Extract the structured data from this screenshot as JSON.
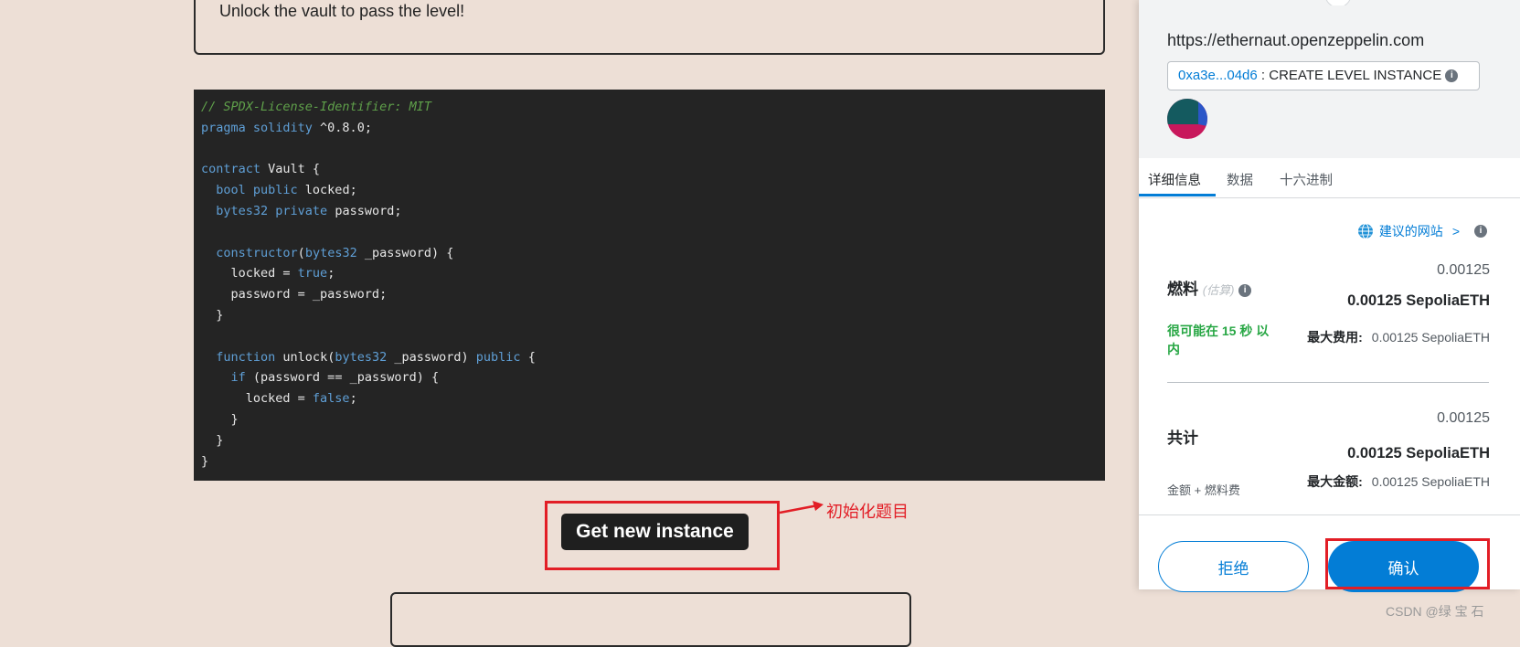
{
  "level": {
    "description": "Unlock the vault to pass the level!"
  },
  "code": {
    "lines": [
      [
        {
          "t": "// SPDX-License-Identifier: MIT",
          "c": "com"
        }
      ],
      [
        {
          "t": "pragma solidity",
          "c": "kw"
        },
        {
          "t": " ^0.8.0;",
          "c": "txt"
        }
      ],
      [],
      [
        {
          "t": "contract",
          "c": "kw"
        },
        {
          "t": " Vault {",
          "c": "txt"
        }
      ],
      [
        {
          "t": "  ",
          "c": "txt"
        },
        {
          "t": "bool public",
          "c": "kw"
        },
        {
          "t": " locked;",
          "c": "txt"
        }
      ],
      [
        {
          "t": "  ",
          "c": "txt"
        },
        {
          "t": "bytes32 private",
          "c": "kw"
        },
        {
          "t": " password;",
          "c": "txt"
        }
      ],
      [],
      [
        {
          "t": "  ",
          "c": "txt"
        },
        {
          "t": "constructor",
          "c": "kw"
        },
        {
          "t": "(",
          "c": "txt"
        },
        {
          "t": "bytes32",
          "c": "kw"
        },
        {
          "t": " _password) {",
          "c": "txt"
        }
      ],
      [
        {
          "t": "    locked = ",
          "c": "txt"
        },
        {
          "t": "true",
          "c": "kw"
        },
        {
          "t": ";",
          "c": "txt"
        }
      ],
      [
        {
          "t": "    password = _password;",
          "c": "txt"
        }
      ],
      [
        {
          "t": "  }",
          "c": "txt"
        }
      ],
      [],
      [
        {
          "t": "  ",
          "c": "txt"
        },
        {
          "t": "function",
          "c": "kw"
        },
        {
          "t": " unlock(",
          "c": "txt"
        },
        {
          "t": "bytes32",
          "c": "kw"
        },
        {
          "t": " _password) ",
          "c": "txt"
        },
        {
          "t": "public",
          "c": "kw"
        },
        {
          "t": " {",
          "c": "txt"
        }
      ],
      [
        {
          "t": "    ",
          "c": "txt"
        },
        {
          "t": "if",
          "c": "kw"
        },
        {
          "t": " (password == _password) {",
          "c": "txt"
        }
      ],
      [
        {
          "t": "      locked = ",
          "c": "txt"
        },
        {
          "t": "false",
          "c": "kw"
        },
        {
          "t": ";",
          "c": "txt"
        }
      ],
      [
        {
          "t": "    }",
          "c": "txt"
        }
      ],
      [
        {
          "t": "  }",
          "c": "txt"
        }
      ],
      [
        {
          "t": "}",
          "c": "txt"
        }
      ]
    ]
  },
  "actions": {
    "get_new_instance": "Get new instance",
    "annotation": "初始化题目"
  },
  "wallet": {
    "site_url": "https://ethernaut.openzeppelin.com",
    "contract_address": "0xa3e...04d6",
    "action_label": ": CREATE LEVEL INSTANCE",
    "tabs": [
      "详细信息",
      "数据",
      "十六进制"
    ],
    "suggested_site": "建议的网站",
    "gas": {
      "label": "燃料",
      "estimate_label": "(估算)",
      "value_small": "0.00125",
      "value_big": "0.00125 SepoliaETH",
      "timing": "很可能在 15 秒 以内",
      "max_fee_label": "最大费用:",
      "max_fee_value": "0.00125 SepoliaETH"
    },
    "total": {
      "label": "共计",
      "value_small": "0.00125",
      "value_big": "0.00125 SepoliaETH",
      "sub_label": "金额 + 燃料费",
      "max_amount_label": "最大金额:",
      "max_amount_value": "0.00125 SepoliaETH"
    },
    "reject_label": "拒绝",
    "confirm_label": "确认"
  },
  "watermark": "CSDN @绿 宝 石",
  "colors": {
    "page_bg": "#eddfd6",
    "code_bg": "#242424",
    "accent_blue": "#037dd6",
    "annotation_red": "#e21e26",
    "success_green": "#28a745"
  }
}
